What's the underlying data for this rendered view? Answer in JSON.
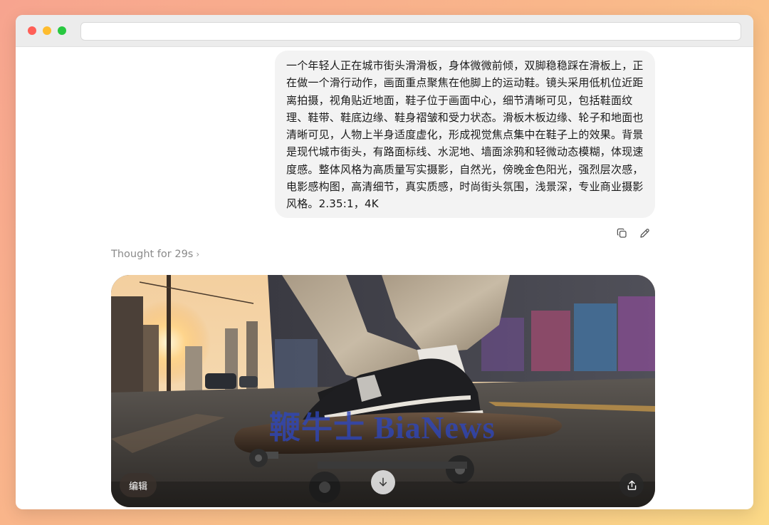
{
  "conversation": {
    "user_message": "一个年轻人正在城市街头滑滑板，身体微微前倾，双脚稳稳踩在滑板上，正在做一个滑行动作，画面重点聚焦在他脚上的运动鞋。镜头采用低机位近距离拍摄，视角贴近地面，鞋子位于画面中心，细节清晰可见，包括鞋面纹理、鞋带、鞋底边缘、鞋身褶皱和受力状态。滑板木板边缘、轮子和地面也清晰可见，人物上半身适度虚化，形成视觉焦点集中在鞋子上的效果。背景是现代城市街头，有路面标线、水泥地、墙面涂鸦和轻微动态模糊，体现速度感。整体风格为高质量写实摄影，自然光，傍晚金色阳光，强烈层次感，电影感构图，高清细节，真实质感，时尚街头氛围，浅景深，专业商业摄影风格。2.35:1，4K",
    "message_actions": {
      "copy_icon": "copy-icon",
      "edit_icon": "pencil-icon"
    },
    "thought_label": "Thought for 29s",
    "thought_chevron": "›"
  },
  "image_result": {
    "watermark": "鞭牛士 BiaNews",
    "edit_label": "编辑",
    "download_icon": "arrow-down-icon",
    "share_icon": "share-icon"
  },
  "colors": {
    "bubble_bg": "#f3f3f3",
    "thought_text": "#8a8a8a",
    "watermark": "#2d46be"
  }
}
